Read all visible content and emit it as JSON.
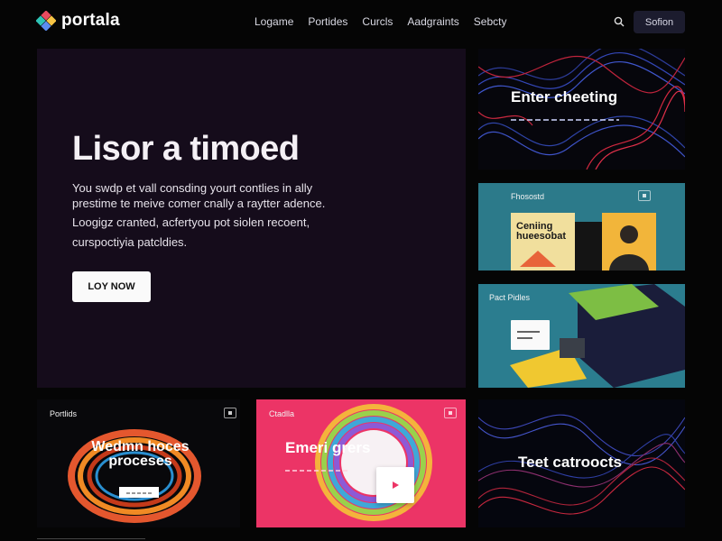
{
  "brand": {
    "name": "portala"
  },
  "nav": {
    "items": [
      "Logame",
      "Portides",
      "Curcls",
      "Aadgraints",
      "Sebcty"
    ],
    "cta_label": "Sofion"
  },
  "hero": {
    "title": "Lisor a timoed",
    "line1": "You swdp et vall consding yourt contlies in ally prestime te meive comer cnally a raytter adence.",
    "line2": "Loogigz cranted, acfertyou pot siolen recoent,",
    "line3": "curspoctiyia patcldies.",
    "button_label": "LOY NOW"
  },
  "cards": {
    "right_top": {
      "title": "Enter cheeting"
    },
    "right_mid": {
      "label": "Fhosostd",
      "headline": "Ceniing hueesobat"
    },
    "right_bottom": {
      "label": "Pact Pidles"
    },
    "bottom_left": {
      "label": "Portlids",
      "title_line1": "Wedmn hoces",
      "title_line2": "proceses"
    },
    "bottom_mid": {
      "label": "Ctadlla",
      "title": "Emeri grers"
    },
    "bottom_right": {
      "title": "Teet catroocts"
    }
  },
  "colors": {
    "background": "#050505",
    "hero_bg": "#150c1b",
    "teal": "#2b7d8f",
    "pink": "#ec3466",
    "button_dark": "#1c1c2e"
  },
  "icons": [
    "logo-mark",
    "search-icon",
    "expand-icon"
  ]
}
